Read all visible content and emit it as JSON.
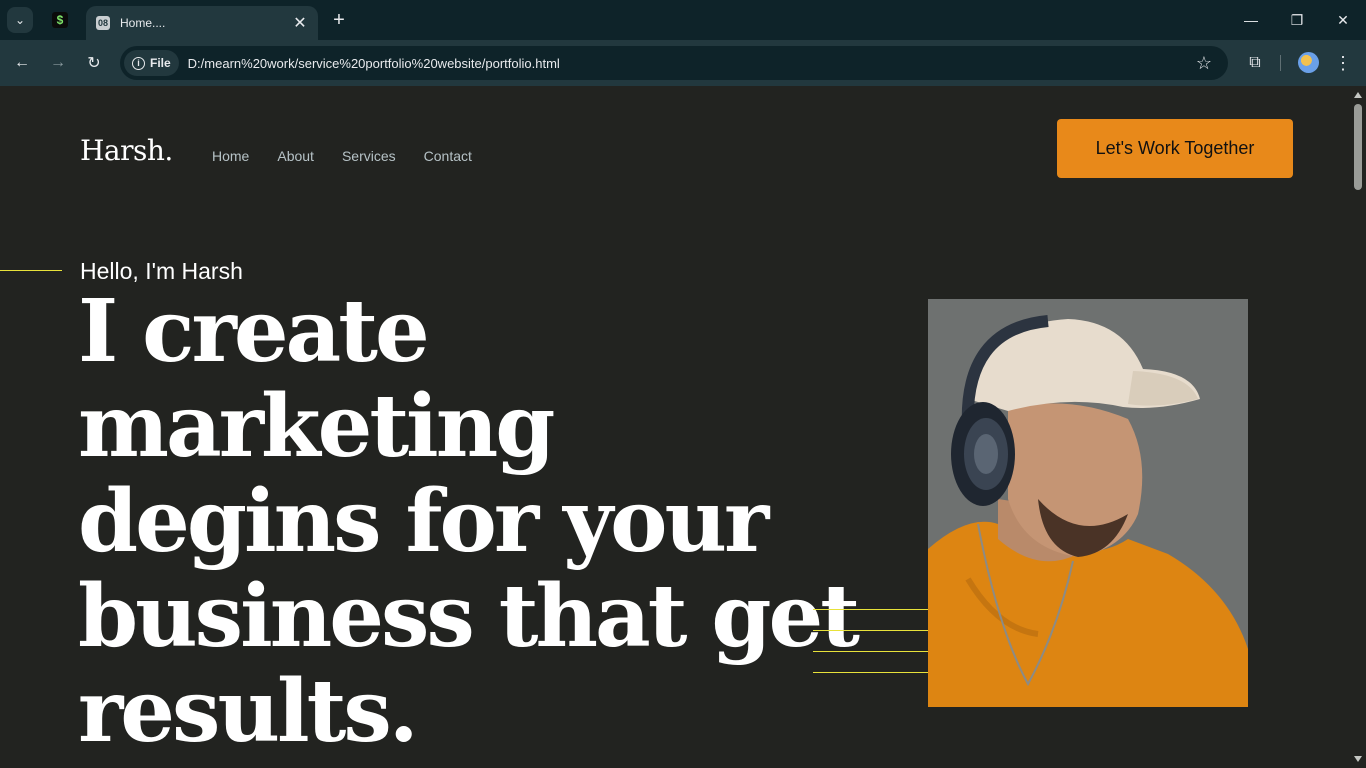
{
  "browser": {
    "pinned_tab_icon": "$",
    "tab_title": "Home....",
    "tab_icon": "08",
    "tab_close": "✕",
    "new_tab": "+",
    "minimize": "—",
    "restore": "❐",
    "close": "✕",
    "back": "←",
    "forward": "→",
    "reload": "↻",
    "scheme_label": "File",
    "info_glyph": "i",
    "url": "D:/mearn%20work/service%20portfolio%20website/portfolio.html",
    "bookmark": "☆",
    "extensions": "⧉",
    "menu": "⋮",
    "tab_menu": "⌄"
  },
  "header": {
    "logo": "Harsh.",
    "nav": [
      "Home",
      "About",
      "Services",
      "Contact"
    ],
    "cta_label": "Let's Work Together"
  },
  "hero": {
    "greeting": "Hello, I'm Harsh",
    "headline": "I create marketing degins for your business that get results."
  },
  "colors": {
    "background": "#222320",
    "accent": "#e8891a",
    "line_accent": "#e8e23a"
  }
}
